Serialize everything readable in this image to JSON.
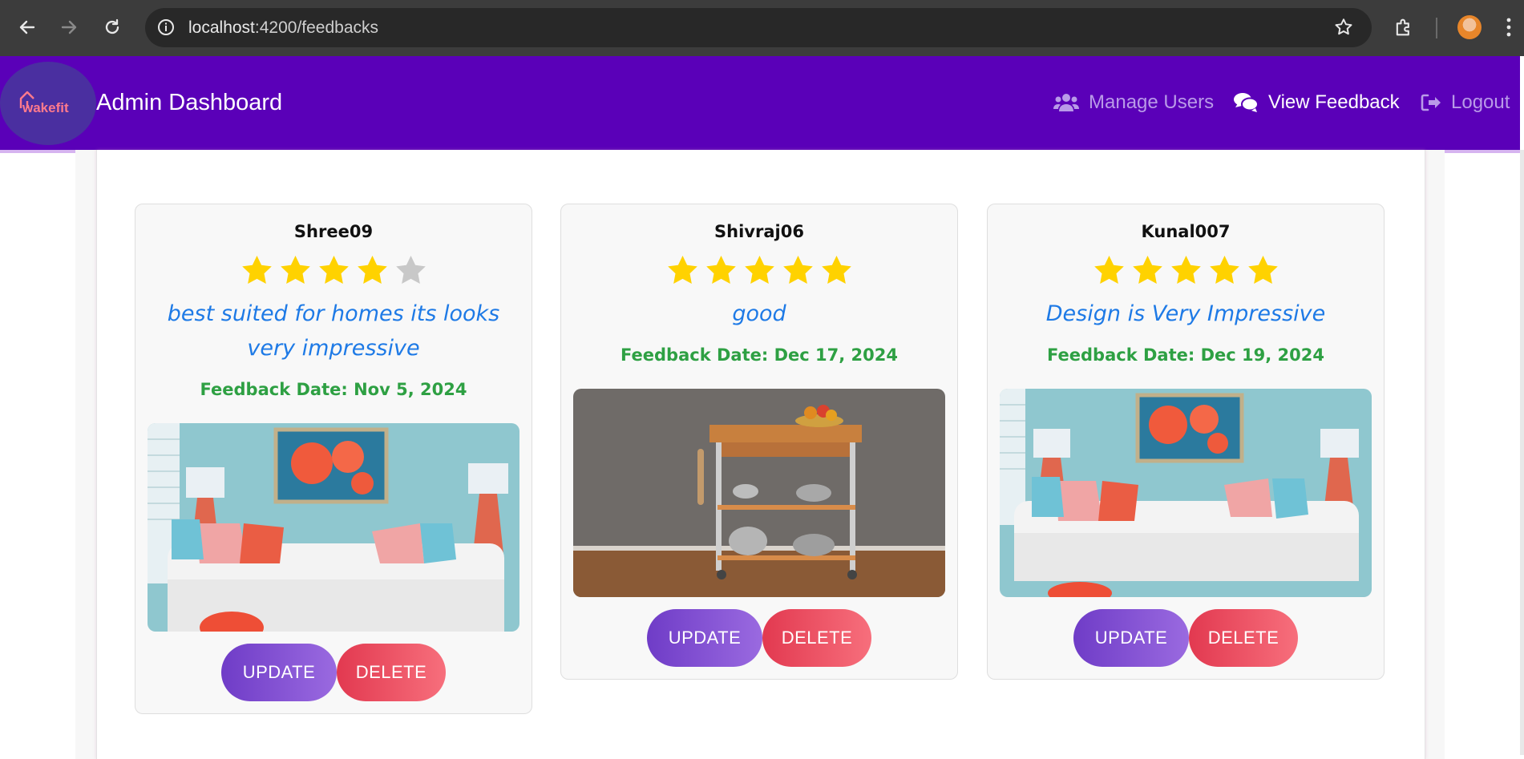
{
  "browser": {
    "url_host": "localhost",
    "url_path": ":4200/feedbacks",
    "icons": [
      "back-icon",
      "forward-icon",
      "reload-icon",
      "site-info-icon",
      "bookmark-star-icon",
      "extensions-icon",
      "profile-avatar",
      "menu-kebab-icon"
    ]
  },
  "header": {
    "logo_text": "wakefit",
    "title": "Admin Dashboard",
    "nav": [
      {
        "label": "Manage Users",
        "icon": "users-icon",
        "active": false
      },
      {
        "label": "View Feedback",
        "icon": "comments-icon",
        "active": true
      },
      {
        "label": "Logout",
        "icon": "logout-icon",
        "active": false
      }
    ],
    "colors": {
      "bar": "#5a00b8",
      "active_link": "#ffffff",
      "inactive_link": "#b99ae8"
    }
  },
  "feedbacks": [
    {
      "username": "Shree09",
      "rating": 4,
      "max_rating": 5,
      "comment": "best suited for homes its looks very impressive",
      "date_label": "Feedback Date: Nov 5, 2024",
      "image": "living-room-sofa",
      "update_label": "UPDATE",
      "delete_label": "DELETE"
    },
    {
      "username": "Shivraj06",
      "rating": 5,
      "max_rating": 5,
      "comment": "good",
      "date_label": "Feedback Date: Dec 17, 2024",
      "image": "kitchen-cart",
      "update_label": "UPDATE",
      "delete_label": "DELETE"
    },
    {
      "username": "Kunal007",
      "rating": 5,
      "max_rating": 5,
      "comment": "Design is Very Impressive",
      "date_label": "Feedback Date: Dec 19, 2024",
      "image": "living-room-sofa",
      "update_label": "UPDATE",
      "delete_label": "DELETE"
    }
  ],
  "colors": {
    "star_filled": "#ffd200",
    "star_empty": "#c8c8c8",
    "comment": "#1e7ae6",
    "date": "#2ea043",
    "update_button": "#7b46cf",
    "delete_button": "#e8485a"
  }
}
